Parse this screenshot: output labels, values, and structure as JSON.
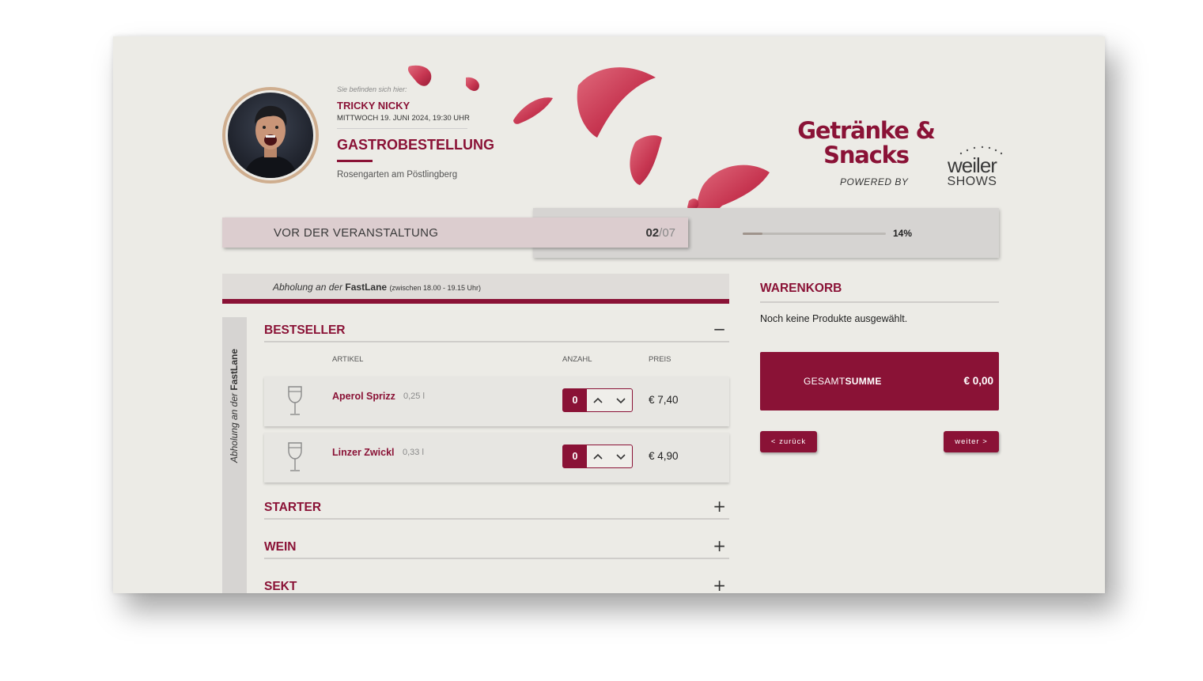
{
  "header": {
    "breadcrumb_label": "Sie befinden sich hier:",
    "show_name": "TRICKY NICKY",
    "show_date": "MITTWOCH 19. JUNI 2024, 19:30 UHR",
    "page_title": "GASTROBESTELLUNG",
    "venue": "Rosengarten am Pöstlingberg"
  },
  "brand": {
    "line1": "Getränke &",
    "line2": "Snacks",
    "powered_by": "POWERED BY",
    "partner_top": "weiler",
    "partner_bottom": "SHOWS"
  },
  "progress": {
    "step_label": "VOR DER VERANSTALTUNG",
    "current_step": "02",
    "separator": "/",
    "total_steps": "07",
    "percent": 14,
    "percent_text": "14%"
  },
  "pickup": {
    "prefix": "Abholung an der ",
    "location": "FastLane",
    "time": "(zwischen 18.00 - 19.15 Uhr)"
  },
  "side_label": {
    "prefix": "Abholung an der ",
    "location": "FastLane"
  },
  "columns": {
    "article": "ARTIKEL",
    "quantity": "ANZAHL",
    "price": "PREIS"
  },
  "categories": [
    {
      "title": "BESTSELLER",
      "toggle": "−"
    },
    {
      "title": "STARTER",
      "toggle": "+"
    },
    {
      "title": "WEIN",
      "toggle": "+"
    },
    {
      "title": "SEKT",
      "toggle": "+"
    }
  ],
  "products": [
    {
      "name": "Aperol Sprizz",
      "size": "0,25 l",
      "qty": "0",
      "price": "€ 7,40",
      "icon": "wine-glass-icon"
    },
    {
      "name": "Linzer Zwickl",
      "size": "0,33 l",
      "qty": "0",
      "price": "€ 4,90",
      "icon": "wine-glass-icon"
    }
  ],
  "cart": {
    "title": "WARENKORB",
    "empty_text": "Noch keine Produkte ausgewählt.",
    "total_prefix": "GESAMT",
    "total_bold": "SUMME",
    "total_value": "€ 0,00"
  },
  "nav": {
    "back": "< zurück",
    "next": "weiter >"
  },
  "colors": {
    "accent": "#8a1236",
    "background": "#ecebe6",
    "step_bar": "#dccdcf",
    "petal": "#c73651"
  }
}
